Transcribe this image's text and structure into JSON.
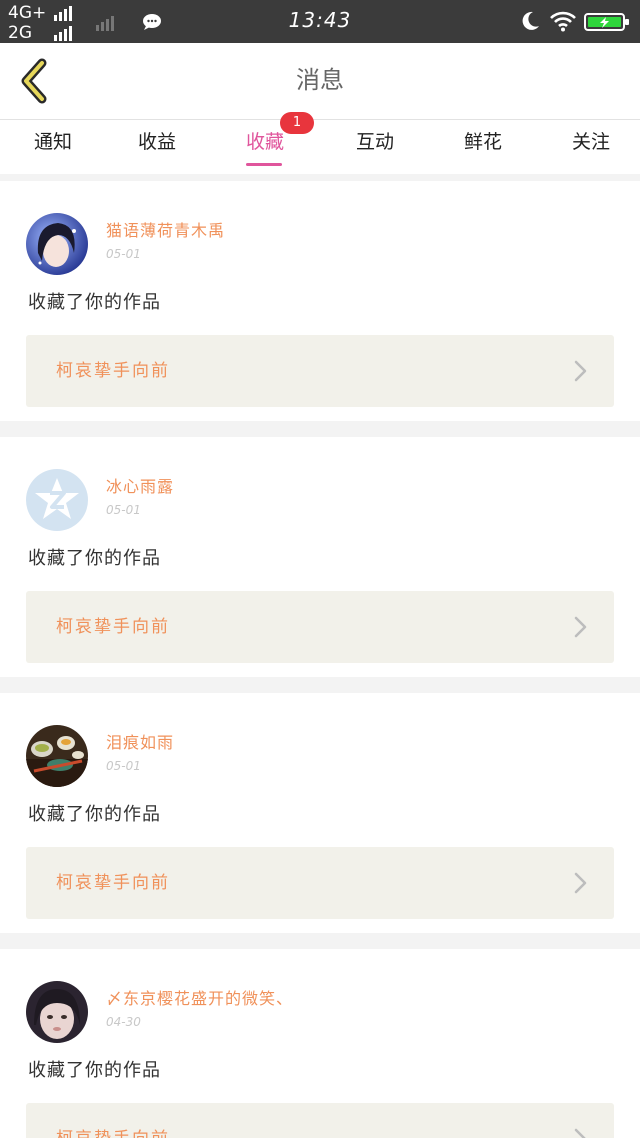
{
  "status_bar": {
    "network_top": "4G+",
    "network_bottom": "2G",
    "time": "13:43",
    "icons": [
      "signal-icon",
      "chat-bubble-icon",
      "moon-icon",
      "wifi-icon",
      "battery-charging-icon"
    ]
  },
  "header": {
    "title": "消息",
    "back_icon": "back-chevron-icon"
  },
  "tabs": [
    {
      "label": "通知"
    },
    {
      "label": "收益"
    },
    {
      "label": "收藏",
      "active": true,
      "badge": "1"
    },
    {
      "label": "互动"
    },
    {
      "label": "鲜花"
    },
    {
      "label": "关注"
    }
  ],
  "colors": {
    "accent": "#e0559c",
    "badge": "#e8353d",
    "username": "#f0915a",
    "work_box_bg": "#f2f1ea"
  },
  "messages": [
    {
      "username": "猫语薄荷青木禹",
      "date": "05-01",
      "action": "收藏了你的作品",
      "work_title": "柯哀挚手向前"
    },
    {
      "username": "冰心雨露",
      "date": "05-01",
      "action": "收藏了你的作品",
      "work_title": "柯哀挚手向前"
    },
    {
      "username": "泪痕如雨",
      "date": "05-01",
      "action": "收藏了你的作品",
      "work_title": "柯哀挚手向前"
    },
    {
      "username": "〆东京樱花盛开的微笑、",
      "date": "04-30",
      "action": "收藏了你的作品",
      "work_title": "柯哀挚手向前"
    }
  ]
}
